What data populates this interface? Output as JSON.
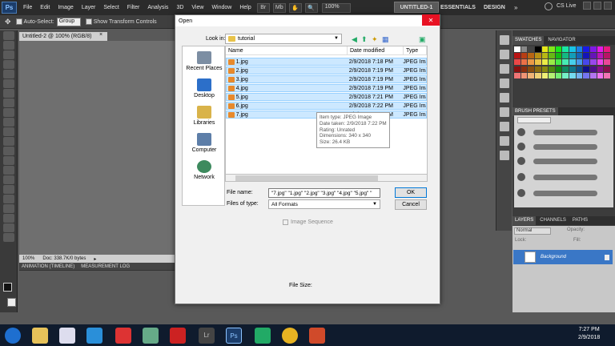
{
  "menubar": {
    "app_icon": "Ps",
    "items": [
      "File",
      "Edit",
      "Image",
      "Layer",
      "Select",
      "Filter",
      "Analysis",
      "3D",
      "View",
      "Window",
      "Help"
    ],
    "zoom": "100%",
    "workspaces": [
      "UNTITLED-1",
      "ESSENTIALS",
      "DESIGN"
    ],
    "cs_live": "CS Live"
  },
  "optionsbar": {
    "auto_select_label": "Auto-Select:",
    "auto_select_value": "Group",
    "show_transform_label": "Show Transform Controls"
  },
  "document": {
    "tab_title": "Untitled-2 @ 100% (RGB/8)",
    "zoom": "100%",
    "doc_info": "Doc: 338.7K/0 bytes",
    "bottom_tabs": [
      "ANIMATION (TIMELINE)",
      "MEASUREMENT LOG"
    ]
  },
  "panels": {
    "swatch_tabs": [
      "SWATCHES",
      "NAVIGATOR"
    ],
    "brush_tab": "BRUSH PRESETS",
    "layers_tabs": [
      "LAYERS",
      "CHANNELS",
      "PATHS"
    ],
    "blend_mode": "Normal",
    "opacity_label": "Opacity:",
    "lock_label": "Lock:",
    "fill_label": "Fill:",
    "layer_name": "Background"
  },
  "dialog": {
    "title": "Open",
    "look_in_label": "Look in:",
    "look_in_value": "tutorial",
    "places": [
      "Recent Places",
      "Desktop",
      "Libraries",
      "Computer",
      "Network"
    ],
    "columns": [
      "Name",
      "Date modified",
      "Type"
    ],
    "files": [
      {
        "name": "1.jpg",
        "date": "2/9/2018 7:18 PM",
        "type": "JPEG Image"
      },
      {
        "name": "2.jpg",
        "date": "2/9/2018 7:19 PM",
        "type": "JPEG Image"
      },
      {
        "name": "3.jpg",
        "date": "2/9/2018 7:19 PM",
        "type": "JPEG Image"
      },
      {
        "name": "4.jpg",
        "date": "2/9/2018 7:19 PM",
        "type": "JPEG Image"
      },
      {
        "name": "5.jpg",
        "date": "2/9/2018 7:21 PM",
        "type": "JPEG Image"
      },
      {
        "name": "6.jpg",
        "date": "2/9/2018 7:22 PM",
        "type": "JPEG Image"
      },
      {
        "name": "7.jpg",
        "date": "2/9/2018 7:22 PM",
        "type": "JPEG Image"
      }
    ],
    "tooltip": [
      "Item type: JPEG Image",
      "Date taken: 2/9/2018 7:22 PM",
      "Rating: Unrated",
      "Dimensions: 340 x 340",
      "Size: 26.4 KB"
    ],
    "file_name_label": "File name:",
    "file_name_value": "\"7.jpg\" \"1.jpg\" \"2.jpg\" \"3.jpg\" \"4.jpg\" \"5.jpg\" \"",
    "files_of_type_label": "Files of type:",
    "files_of_type_value": "All Formats",
    "ok_label": "OK",
    "cancel_label": "Cancel",
    "image_sequence_label": "Image Sequence",
    "file_size_label": "File Size:"
  },
  "taskbar": {
    "time": "7:27 PM",
    "date": "2/9/2018"
  },
  "colors": {
    "selection": "#cce8ff",
    "close": "#e81123",
    "layer_selected": "#3a77c6"
  }
}
